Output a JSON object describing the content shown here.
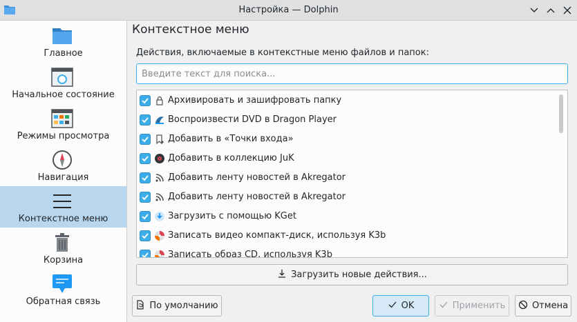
{
  "window": {
    "title": "Настройка — Dolphin"
  },
  "sidebar": {
    "items": [
      {
        "label": "Главное",
        "icon": "folder-icon"
      },
      {
        "label": "Начальное состояние",
        "icon": "startup-window-icon"
      },
      {
        "label": "Режимы просмотра",
        "icon": "view-modes-icon"
      },
      {
        "label": "Навигация",
        "icon": "compass-icon"
      },
      {
        "label": "Контекстное меню",
        "icon": "hamburger-menu-icon"
      },
      {
        "label": "Корзина",
        "icon": "trash-icon"
      },
      {
        "label": "Обратная связь",
        "icon": "feedback-icon"
      }
    ],
    "active_index": 4
  },
  "page": {
    "title": "Контекстное меню",
    "actions_label": "Действия, включаемые в контекстные меню файлов и папок:",
    "search_placeholder": "Введите текст для поиска...",
    "search_value": ""
  },
  "actions": [
    {
      "label": "Архивировать и зашифровать папку",
      "checked": true,
      "icon": "lock-icon"
    },
    {
      "label": "Воспроизвести DVD в Dragon Player",
      "checked": true,
      "icon": "dragon-player-icon"
    },
    {
      "label": "Добавить в «Точки входа»",
      "checked": true,
      "icon": "bookmark-add-icon"
    },
    {
      "label": "Добавить в коллекцию JuK",
      "checked": true,
      "icon": "juk-icon"
    },
    {
      "label": "Добавить ленту новостей в Akregator",
      "checked": true,
      "icon": "rss-icon"
    },
    {
      "label": "Добавить ленту новостей в Akregator",
      "checked": true,
      "icon": "rss-icon"
    },
    {
      "label": "Загрузить с помощью KGet",
      "checked": true,
      "icon": "kget-icon"
    },
    {
      "label": "Записать видео компакт-диск, используя K3b",
      "checked": true,
      "icon": "k3b-icon"
    },
    {
      "label": "Записать образ CD, используя K3b",
      "checked": true,
      "icon": "k3b-icon"
    }
  ],
  "buttons": {
    "download_actions": "Загрузить новые действия...",
    "defaults": "По умолчанию",
    "ok": "OK",
    "apply": "Применить",
    "cancel": "Отмена"
  },
  "colors": {
    "accent": "#3daee9",
    "selection": "#b8d7ef",
    "window_bg": "#eff0f1"
  }
}
